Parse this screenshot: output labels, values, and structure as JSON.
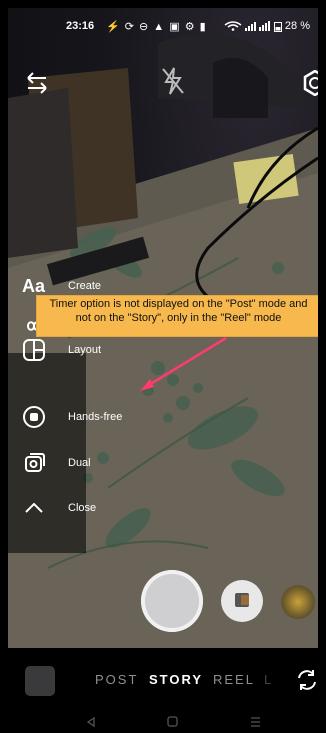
{
  "status_bar": {
    "time": "23:16",
    "left_icons": "⚡ ⟳ ⊖ ▲   ▣ ⚙ ▮ ",
    "battery": "28 %"
  },
  "side_menu": {
    "create": {
      "icon_text": "Aa",
      "label": "Create"
    },
    "layout": {
      "label": "Layout"
    },
    "hands_free": {
      "label": "Hands-free"
    },
    "dual": {
      "label": "Dual"
    },
    "close": {
      "label": "Close"
    }
  },
  "annotation": {
    "text": "Timer option is not displayed on the \"Post\" mode and not on the \"Story\", only in the \"Reel\" mode",
    "color": "#f7b84e",
    "arrow_color": "#ff3b6f"
  },
  "modes": {
    "post": "POST",
    "story": "STORY",
    "reel": "REEL",
    "live": "L"
  },
  "colors": {
    "accent": "#ffffff",
    "muted": "#8e8e8e"
  }
}
